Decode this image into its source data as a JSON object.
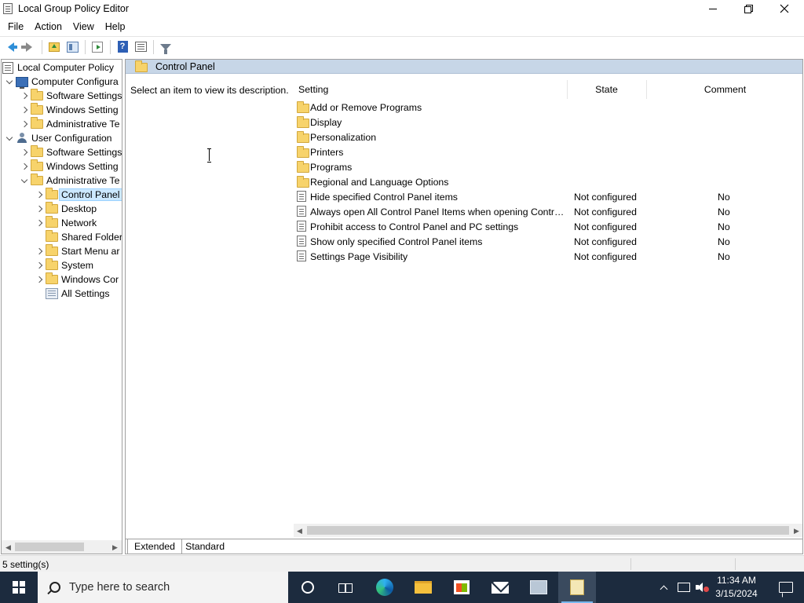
{
  "window": {
    "title": "Local Group Policy Editor"
  },
  "menu": [
    "File",
    "Action",
    "View",
    "Help"
  ],
  "toolbar": {
    "buttons": [
      "back-icon",
      "forward-icon",
      "up-folder-icon",
      "show-tree-icon",
      "export-list-icon",
      "help-icon",
      "properties-icon",
      "filter-icon"
    ]
  },
  "tree": {
    "root": "Local Computer Policy",
    "computer_config": "Computer Configura",
    "cc_software": "Software Settings",
    "cc_windows": "Windows Setting",
    "cc_admin": "Administrative Te",
    "user_config": "User Configuration",
    "uc_software": "Software Settings",
    "uc_windows": "Windows Setting",
    "uc_admin": "Administrative Te",
    "control_panel": "Control Panel",
    "desktop": "Desktop",
    "network": "Network",
    "shared_folders": "Shared Folder",
    "start_menu": "Start Menu ar",
    "system": "System",
    "windows_components": "Windows Cor",
    "all_settings": "All Settings"
  },
  "right": {
    "header_title": "Control Panel",
    "description": "Select an item to view its description.",
    "columns": {
      "setting": "Setting",
      "state": "State",
      "comment": "Comment"
    },
    "rows": [
      {
        "type": "folder",
        "name": "Add or Remove Programs",
        "state": "",
        "comment": ""
      },
      {
        "type": "folder",
        "name": "Display",
        "state": "",
        "comment": ""
      },
      {
        "type": "folder",
        "name": "Personalization",
        "state": "",
        "comment": ""
      },
      {
        "type": "folder",
        "name": "Printers",
        "state": "",
        "comment": ""
      },
      {
        "type": "folder",
        "name": "Programs",
        "state": "",
        "comment": ""
      },
      {
        "type": "folder",
        "name": "Regional and Language Options",
        "state": "",
        "comment": ""
      },
      {
        "type": "setting",
        "name": "Hide specified Control Panel items",
        "state": "Not configured",
        "comment": "No"
      },
      {
        "type": "setting",
        "name": "Always open All Control Panel Items when opening Control ...",
        "state": "Not configured",
        "comment": "No"
      },
      {
        "type": "setting",
        "name": "Prohibit access to Control Panel and PC settings",
        "state": "Not configured",
        "comment": "No"
      },
      {
        "type": "setting",
        "name": "Show only specified Control Panel items",
        "state": "Not configured",
        "comment": "No"
      },
      {
        "type": "setting",
        "name": "Settings Page Visibility",
        "state": "Not configured",
        "comment": "No"
      }
    ],
    "tabs": {
      "extended": "Extended",
      "standard": "Standard"
    }
  },
  "status": {
    "text": "5 setting(s)"
  },
  "taskbar": {
    "search_placeholder": "Type here to search",
    "time": "11:34 AM",
    "date": "3/15/2024"
  }
}
